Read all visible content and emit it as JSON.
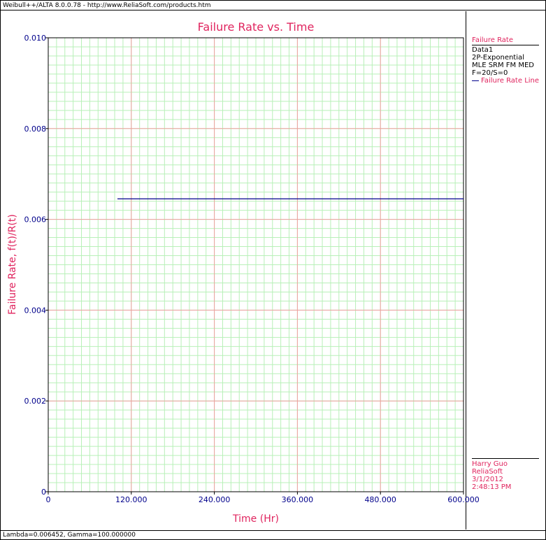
{
  "window": {
    "title": "Weibull++/ALTA 8.0.0.78 - http://www.ReliaSoft.com/products.htm",
    "status": "Lambda=0.006452, Gamma=100.000000"
  },
  "legend": {
    "header": "Failure Rate",
    "lines": [
      "Data1",
      "2P-Exponential",
      "MLE SRM FM MED",
      "F=20/S=0"
    ],
    "series_label": "Failure Rate Line"
  },
  "credits": {
    "user": "Harry Guo",
    "company": "ReliaSoft",
    "date": "3/1/2012",
    "time": "2:48:13 PM"
  },
  "colors": {
    "title": "#e0245e",
    "tick_label": "#00008b",
    "major_grid": "#f0a0a0",
    "minor_grid": "#b8f0b8",
    "series": "#00008b"
  },
  "chart_data": {
    "type": "line",
    "title": "Failure Rate vs. Time",
    "xlabel": "Time (Hr)",
    "ylabel": "Failure Rate, f(t)/R(t)",
    "xlim": [
      0,
      600
    ],
    "ylim": [
      0,
      0.01
    ],
    "xticks": [
      0,
      120,
      240,
      360,
      480,
      600
    ],
    "xtick_labels": [
      "0",
      "120.000",
      "240.000",
      "360.000",
      "480.000",
      "600.000"
    ],
    "yticks": [
      0,
      0.002,
      0.004,
      0.006,
      0.008,
      0.01
    ],
    "ytick_labels": [
      "0",
      "0.002",
      "0.004",
      "0.006",
      "0.008",
      "0.010"
    ],
    "grid": true,
    "series": [
      {
        "name": "Failure Rate Line",
        "x": [
          100,
          600
        ],
        "y": [
          0.006452,
          0.006452
        ]
      }
    ]
  }
}
